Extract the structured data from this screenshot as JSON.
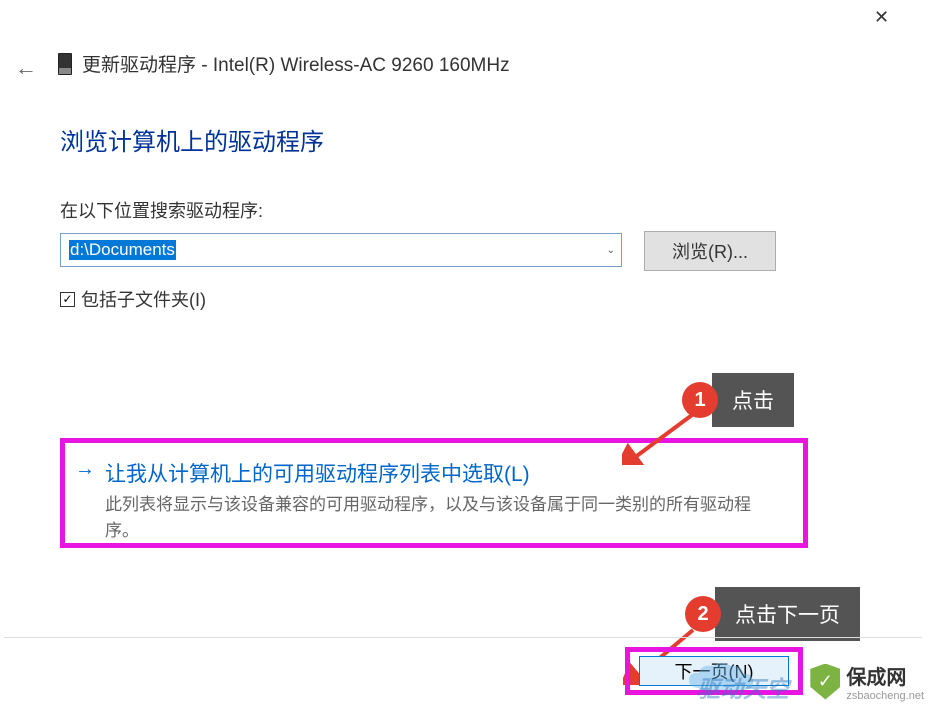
{
  "window": {
    "title_prefix": "更新驱动程序 - ",
    "device_name": "Intel(R) Wireless-AC 9260 160MHz"
  },
  "page": {
    "heading": "浏览计算机上的驱动程序",
    "search_label": "在以下位置搜索驱动程序:",
    "path_value": "d:\\Documents",
    "browse_btn": "浏览(R)...",
    "include_subfolders": "包括子文件夹(I)",
    "option": {
      "title": "让我从计算机上的可用驱动程序列表中选取(L)",
      "desc": "此列表将显示与该设备兼容的可用驱动程序，以及与该设备属于同一类别的所有驱动程序。"
    },
    "next_btn": "下一页(N)"
  },
  "annotations": {
    "a1": {
      "num": "1",
      "label": "点击"
    },
    "a2": {
      "num": "2",
      "label": "点击下一页"
    }
  },
  "watermark": {
    "brand": "保成网",
    "url": "zsbaocheng.net",
    "cloud": "驱动天空"
  }
}
